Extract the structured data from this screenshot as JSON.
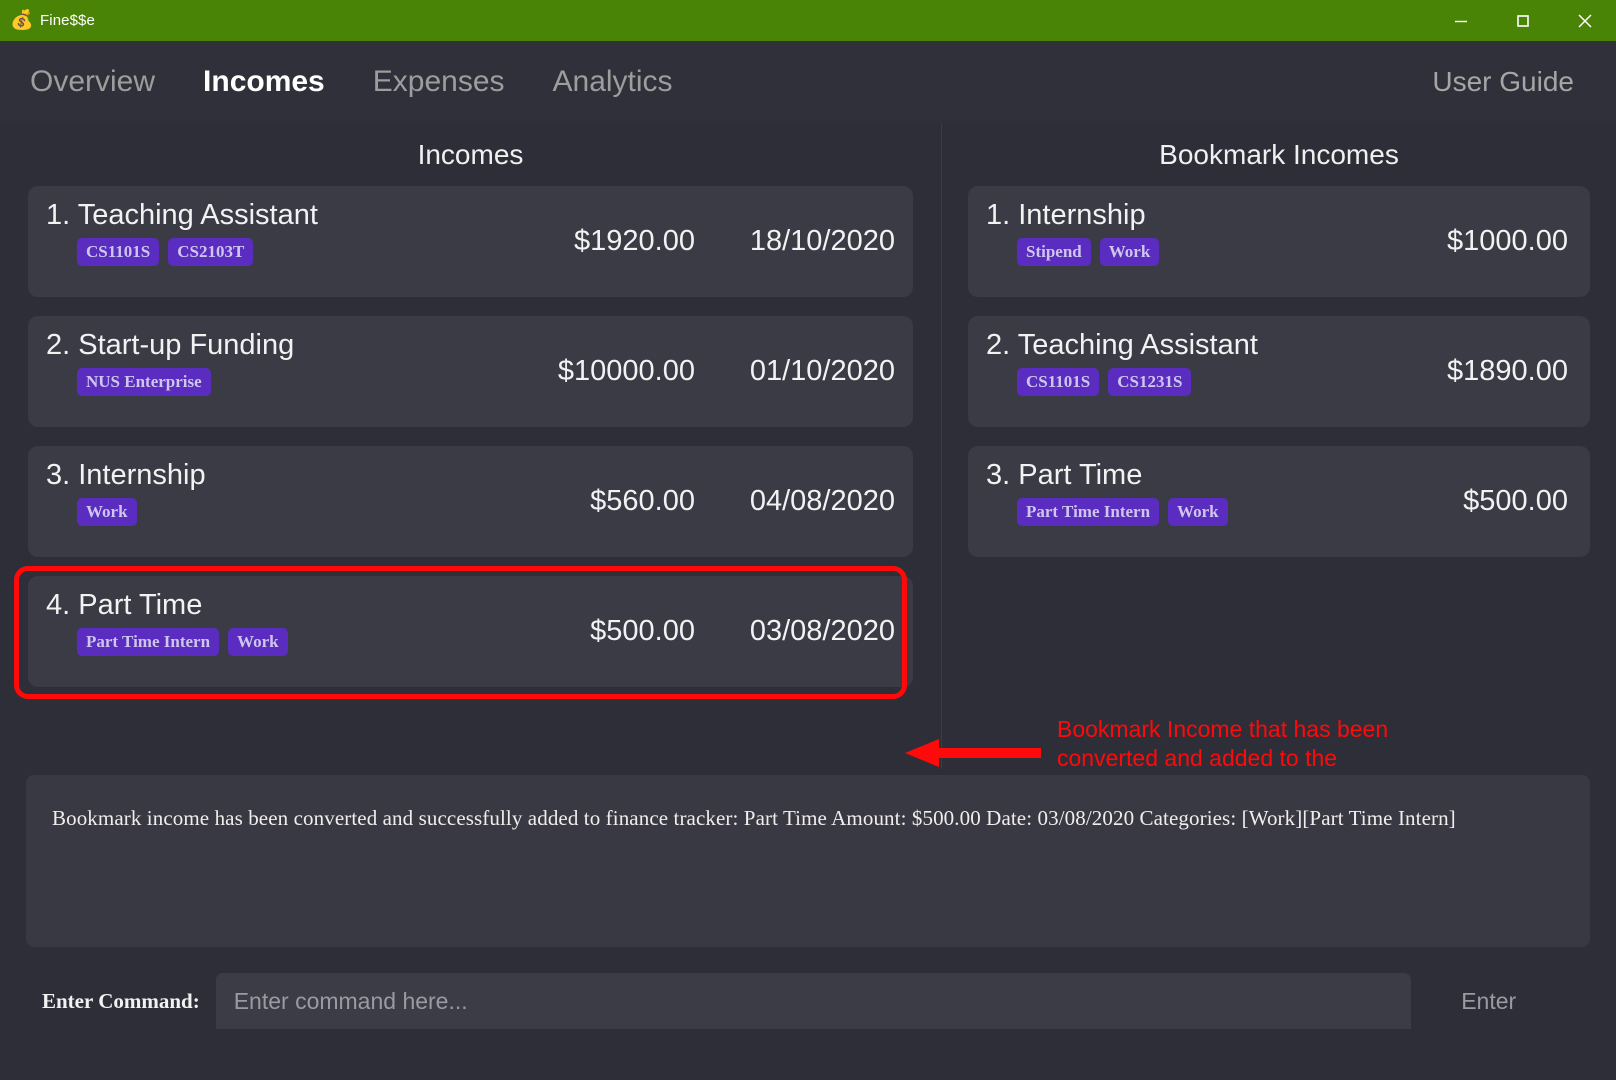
{
  "window": {
    "icon": "money-bag-icon",
    "title": "Fine$$e",
    "titlebar_color": "#4a8406",
    "minimize_label": "Minimize",
    "maximize_label": "Maximize",
    "close_label": "Close"
  },
  "nav": {
    "tabs": [
      {
        "label": "Overview",
        "active": false
      },
      {
        "label": "Incomes",
        "active": true
      },
      {
        "label": "Expenses",
        "active": false
      },
      {
        "label": "Analytics",
        "active": false
      }
    ],
    "user_guide": "User Guide"
  },
  "incomes_panel": {
    "title": "Incomes",
    "items": [
      {
        "index": "1.",
        "name": "Teaching Assistant",
        "label": "1. Teaching Assistant",
        "tags": [
          "CS1101S",
          "CS2103T"
        ],
        "amount": "$1920.00",
        "date": "18/10/2020",
        "highlighted": false
      },
      {
        "index": "2.",
        "name": "Start-up Funding",
        "label": "2. Start-up Funding",
        "tags": [
          "NUS Enterprise"
        ],
        "amount": "$10000.00",
        "date": "01/10/2020",
        "highlighted": false
      },
      {
        "index": "3.",
        "name": "Internship",
        "label": "3. Internship",
        "tags": [
          "Work"
        ],
        "amount": "$560.00",
        "date": "04/08/2020",
        "highlighted": false
      },
      {
        "index": "4.",
        "name": "Part Time",
        "label": "4. Part Time",
        "tags": [
          "Part Time Intern",
          "Work"
        ],
        "amount": "$500.00",
        "date": "03/08/2020",
        "highlighted": true
      }
    ]
  },
  "bookmarks_panel": {
    "title": "Bookmark Incomes",
    "items": [
      {
        "index": "1.",
        "name": "Internship",
        "label": "1. Internship",
        "tags": [
          "Stipend",
          "Work"
        ],
        "amount": "$1000.00"
      },
      {
        "index": "2.",
        "name": "Teaching Assistant",
        "label": "2. Teaching Assistant",
        "tags": [
          "CS1101S",
          "CS1231S"
        ],
        "amount": "$1890.00"
      },
      {
        "index": "3.",
        "name": "Part Time",
        "label": "3. Part Time",
        "tags": [
          "Part Time Intern",
          "Work"
        ],
        "amount": "$500.00"
      }
    ]
  },
  "annotation": {
    "text": "Bookmark Income that has been converted and added to the Incomes List",
    "color": "#ff0a0a",
    "arrow": "left-arrow-icon"
  },
  "result_box": {
    "message": "Bookmark income has been converted and successfully added to finance tracker: Part Time Amount: $500.00 Date: 03/08/2020 Categories: [Work][Part Time Intern]"
  },
  "command_bar": {
    "label": "Enter Command:",
    "input_value": "",
    "placeholder": "Enter command here...",
    "enter_button": "Enter"
  },
  "colors": {
    "page_background": "#2d2e38",
    "card_background": "#3a3b45",
    "tag_background": "#5a2cc0",
    "tag_text": "#cfc6ee",
    "accent_green": "#4a8406",
    "annotation_red": "#ff0a0a"
  }
}
